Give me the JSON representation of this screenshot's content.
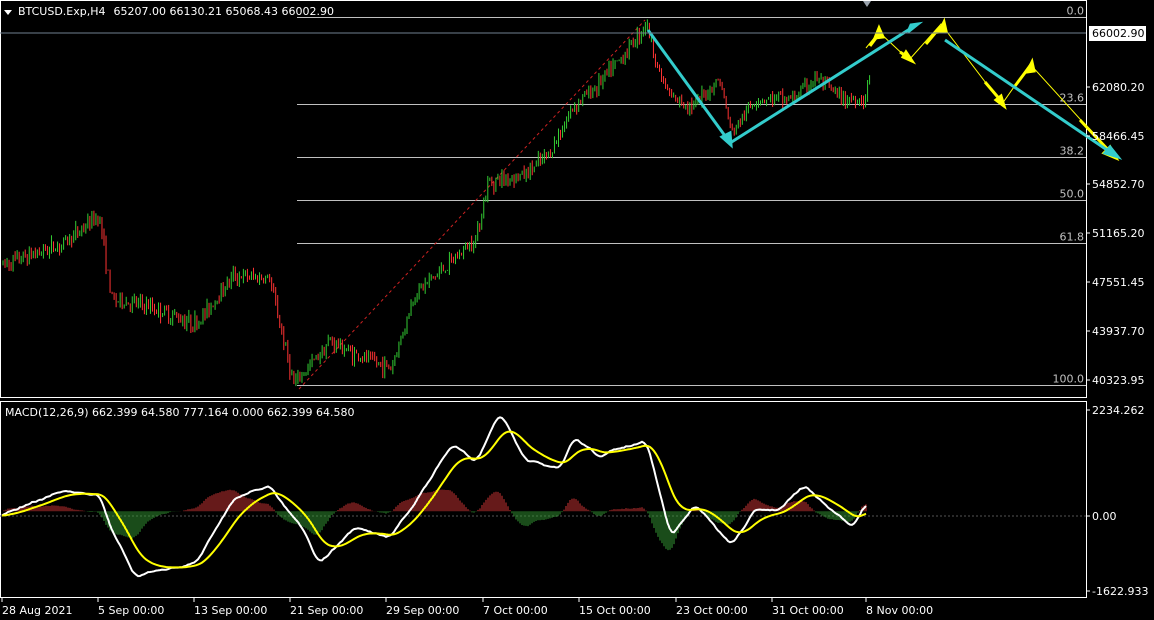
{
  "header": {
    "symbol": "BTCUSD.Exp,H4",
    "ohlc": "65207.00 66130.21 65068.43 66002.90"
  },
  "macd": {
    "title": "MACD(12,26,9) 662.399 64.580 777.164 0.000 662.399 64.580"
  },
  "colors": {
    "bull": "#33cc33",
    "bear": "#ff3333",
    "macd_line": "#ffffff",
    "signal_line": "#ffff00",
    "hist_up": "#cc3333",
    "hist_down": "#339933",
    "zigzag": "#ffff00",
    "trend": "#33cccc",
    "fib": "#c0c0c0"
  },
  "chart_data": [
    {
      "type": "candlestick",
      "x_dates": [
        "28 Aug 2021",
        "5 Sep 00:00",
        "13 Sep 00:00",
        "21 Sep 00:00",
        "29 Sep 00:00",
        "7 Oct 00:00",
        "15 Oct 00:00",
        "23 Oct 00:00",
        "31 Oct 00:00",
        "8 Nov 00:00"
      ],
      "y_ticks": [
        "62080.20",
        "58466.45",
        "54852.70",
        "51165.20",
        "47551.45",
        "43937.70",
        "40323.95"
      ],
      "ylim": [
        39500,
        68000
      ],
      "current_price": "66002.90",
      "price_anchors": [
        {
          "x": "28 Aug 2021",
          "y": 49000
        },
        {
          "x": "2 Sep",
          "y": 50500
        },
        {
          "x": "5 Sep",
          "y": 52600
        },
        {
          "x": "6 Sep",
          "y": 46500
        },
        {
          "x": "9 Sep",
          "y": 46000
        },
        {
          "x": "13 Sep",
          "y": 44700
        },
        {
          "x": "16 Sep",
          "y": 48200
        },
        {
          "x": "19 Sep",
          "y": 48000
        },
        {
          "x": "21 Sep",
          "y": 40300
        },
        {
          "x": "24 Sep",
          "y": 43500
        },
        {
          "x": "26 Sep",
          "y": 42500
        },
        {
          "x": "29 Sep",
          "y": 41500
        },
        {
          "x": "1 Oct",
          "y": 47000
        },
        {
          "x": "4 Oct",
          "y": 49200
        },
        {
          "x": "6 Oct",
          "y": 51000
        },
        {
          "x": "7 Oct",
          "y": 55000
        },
        {
          "x": "10 Oct",
          "y": 55500
        },
        {
          "x": "12 Oct",
          "y": 57000
        },
        {
          "x": "14 Oct",
          "y": 60500
        },
        {
          "x": "16 Oct",
          "y": 62000
        },
        {
          "x": "18 Oct",
          "y": 64000
        },
        {
          "x": "20 Oct",
          "y": 66500
        },
        {
          "x": "21 Oct",
          "y": 63000
        },
        {
          "x": "22 Oct",
          "y": 61000
        },
        {
          "x": "24 Oct",
          "y": 60500
        },
        {
          "x": "26 Oct",
          "y": 62500
        },
        {
          "x": "27 Oct",
          "y": 58500
        },
        {
          "x": "29 Oct",
          "y": 61000
        },
        {
          "x": "1 Nov",
          "y": 61000
        },
        {
          "x": "3 Nov",
          "y": 62500
        },
        {
          "x": "5 Nov",
          "y": 61000
        },
        {
          "x": "7 Nov",
          "y": 61000
        },
        {
          "x": "8 Nov",
          "y": 66000
        }
      ]
    },
    {
      "type": "fibonacci",
      "levels": [
        {
          "label": "0.0",
          "price": 66900
        },
        {
          "label": "23.6",
          "price": 60600
        },
        {
          "label": "38.2",
          "price": 56800
        },
        {
          "label": "50.0",
          "price": 53700
        },
        {
          "label": "61.8",
          "price": 50600
        },
        {
          "label": "100.0",
          "price": 40300
        }
      ]
    },
    {
      "type": "line",
      "name": "MACD(12,26,9)",
      "y_ticks": [
        "2234.262",
        "0.00",
        "-1622.933"
      ],
      "ylim": [
        -1830,
        2340
      ],
      "macd_anchors": [
        {
          "x": "28 Aug 2021",
          "y": -100
        },
        {
          "x": "2 Sep",
          "y": 450
        },
        {
          "x": "5 Sep",
          "y": 350
        },
        {
          "x": "6 Sep",
          "y": -400
        },
        {
          "x": "8 Sep",
          "y": -1400
        },
        {
          "x": "13 Sep",
          "y": -1100
        },
        {
          "x": "16 Sep",
          "y": 250
        },
        {
          "x": "19 Sep",
          "y": 550
        },
        {
          "x": "22 Sep",
          "y": -500
        },
        {
          "x": "23 Sep",
          "y": -1150
        },
        {
          "x": "26 Sep",
          "y": -350
        },
        {
          "x": "29 Sep",
          "y": -550
        },
        {
          "x": "1 Oct",
          "y": 200
        },
        {
          "x": "4 Oct",
          "y": 1450
        },
        {
          "x": "6 Oct",
          "y": 1050
        },
        {
          "x": "8 Oct",
          "y": 2150
        },
        {
          "x": "10 Oct",
          "y": 1150
        },
        {
          "x": "11 Oct",
          "y": 1050
        },
        {
          "x": "13 Oct",
          "y": 950
        },
        {
          "x": "14 Oct",
          "y": 1600
        },
        {
          "x": "16 Oct",
          "y": 1200
        },
        {
          "x": "20 Oct",
          "y": 1550
        },
        {
          "x": "22 Oct",
          "y": -550
        },
        {
          "x": "24 Oct",
          "y": 150
        },
        {
          "x": "27 Oct",
          "y": -750
        },
        {
          "x": "29 Oct",
          "y": 50
        },
        {
          "x": "31 Oct",
          "y": 40
        },
        {
          "x": "2 Nov",
          "y": 550
        },
        {
          "x": "4 Nov",
          "y": 100
        },
        {
          "x": "6 Nov",
          "y": -350
        },
        {
          "x": "8 Nov",
          "y": 700
        }
      ]
    }
  ]
}
